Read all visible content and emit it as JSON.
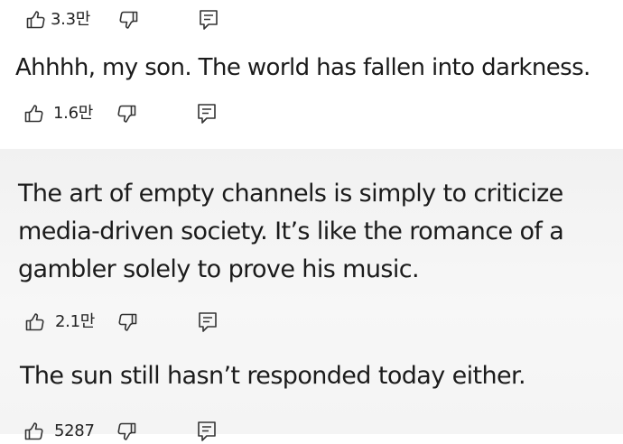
{
  "comments": [
    {
      "text": "",
      "like_count": "3.3만",
      "icons": [
        "thumbs-up-icon",
        "thumbs-down-icon",
        "reply-icon"
      ]
    },
    {
      "text": "Ahhhh, my son. The world has fallen into darkness.",
      "like_count": "1.6만",
      "icons": [
        "thumbs-up-icon",
        "thumbs-down-icon",
        "reply-icon"
      ]
    },
    {
      "text_lines": [
        "The art of empty channels is simply to criticize",
        "media-driven society. It’s like the romance of a",
        "gambler solely to prove his music."
      ],
      "like_count": "2.1만",
      "icons": [
        "thumbs-up-icon",
        "thumbs-down-icon",
        "reply-icon"
      ]
    },
    {
      "text": "The sun still hasn’t responded today either.",
      "like_count": "5287",
      "icons": [
        "thumbs-up-icon",
        "thumbs-down-icon",
        "reply-icon"
      ]
    }
  ],
  "colors": {
    "text": "#1b1b1b",
    "icon_stroke": "#333333",
    "top_background": "#ffffff",
    "bottom_background": "#f3f3f3"
  }
}
